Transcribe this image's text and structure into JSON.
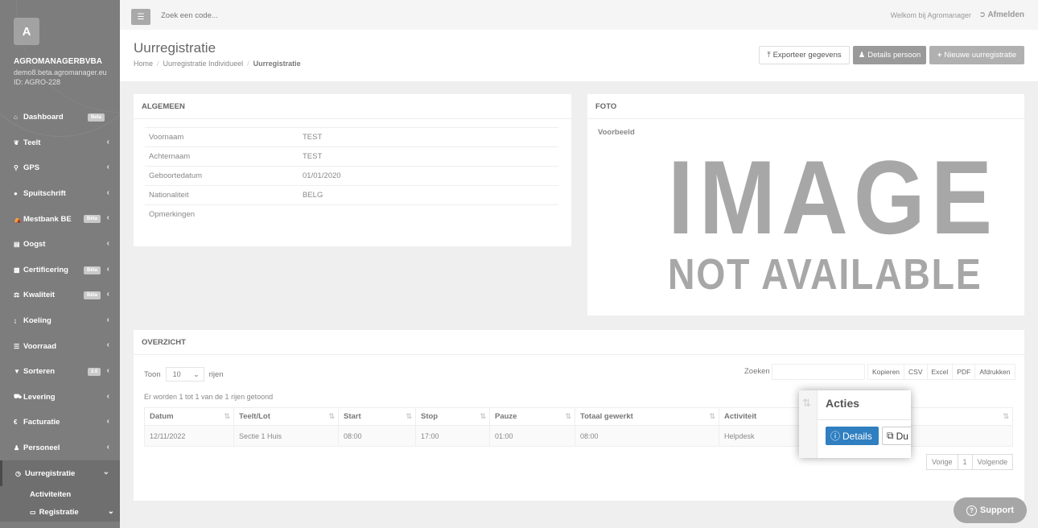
{
  "sidebar": {
    "avatar_letter": "A",
    "org_name": "AGROMANAGERBVBA",
    "org_email": "demo8.beta.agromanager.eu",
    "org_id": "ID: AGRO-228",
    "items": [
      {
        "label": "Dashboard",
        "icon": "home-icon",
        "badge": "Beta"
      },
      {
        "label": "Teelt",
        "icon": "leaf-icon"
      },
      {
        "label": "GPS",
        "icon": "map-marker-icon"
      },
      {
        "label": "Spuitschrift",
        "icon": "drop-icon"
      },
      {
        "label": "Mestbank BE",
        "icon": "bank-icon",
        "badge": "Bèta"
      },
      {
        "label": "Oogst",
        "icon": "basket-icon"
      },
      {
        "label": "Certificering",
        "icon": "certificate-icon",
        "badge": "Bèta"
      },
      {
        "label": "Kwaliteit",
        "icon": "balance-icon",
        "badge": "Bèta"
      },
      {
        "label": "Koeling",
        "icon": "thermometer-icon"
      },
      {
        "label": "Voorraad",
        "icon": "list-icon"
      },
      {
        "label": "Sorteren",
        "icon": "filter-icon",
        "badge": "2.0"
      },
      {
        "label": "Levering",
        "icon": "truck-icon"
      },
      {
        "label": "Facturatie",
        "icon": "euro-icon"
      },
      {
        "label": "Personeel",
        "icon": "user-icon"
      },
      {
        "label": "Uurregistratie",
        "icon": "clock-icon"
      }
    ],
    "sub_items": [
      {
        "label": "Activiteiten"
      },
      {
        "label": "Registratie",
        "icon": "folder-open-icon"
      }
    ]
  },
  "topbar": {
    "search_placeholder": "Zoek een code...",
    "welcome": "Welkom bij Agromanager",
    "logout": "Afmelden"
  },
  "header": {
    "title": "Uurregistratie",
    "breadcrumb": [
      "Home",
      "Uurregistratie Individueel",
      "Uurregistratie"
    ],
    "export_label": "Exporteer gegevens",
    "details_label": "Details persoon",
    "new_label": "Nieuwe uurregistratie"
  },
  "algemeen": {
    "title": "ALGEMEEN",
    "rows": [
      {
        "label": "Voornaam",
        "value": "TEST"
      },
      {
        "label": "Achternaam",
        "value": "TEST"
      },
      {
        "label": "Geboortedatum",
        "value": "01/01/2020"
      },
      {
        "label": "Nationaliteit",
        "value": "BELG"
      },
      {
        "label": "Opmerkingen",
        "value": ""
      }
    ]
  },
  "foto": {
    "title": "FOTO",
    "label": "Voorbeeld",
    "placeholder_big": "IMAGE",
    "placeholder_small": "NOT AVAILABLE"
  },
  "overzicht": {
    "title": "OVERZICHT",
    "toon": "Toon",
    "rows_value": "10",
    "rijen": "rijen",
    "zoeken": "Zoeken",
    "export_buttons": [
      "Kopieren",
      "CSV",
      "Excel",
      "PDF",
      "Afdrukken"
    ],
    "count_text": "Er worden 1 tot 1 van de 1 rijen getoond",
    "columns": [
      "Datum",
      "Teelt/Lot",
      "Start",
      "Stop",
      "Pauze",
      "Totaal gewerkt",
      "Activiteit",
      ""
    ],
    "rows": [
      [
        "12/11/2022",
        "Sectie 1 Huis",
        "08:00",
        "17:00",
        "01:00",
        "08:00",
        "Helpdesk",
        ""
      ]
    ],
    "pager": [
      "Vorige",
      "1",
      "Volgende"
    ]
  },
  "popup": {
    "header": "Acties",
    "details_label": "Details",
    "copy_label": "Du"
  },
  "support_label": "Support"
}
